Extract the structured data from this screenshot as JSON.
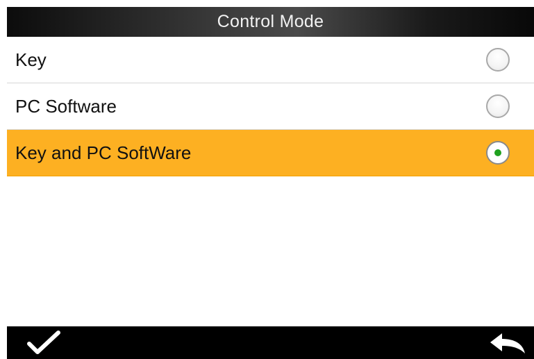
{
  "header": {
    "title": "Control Mode"
  },
  "options": [
    {
      "label": "Key",
      "selected": false
    },
    {
      "label": "PC Software",
      "selected": false
    },
    {
      "label": "Key and PC SoftWare",
      "selected": true
    }
  ],
  "toolbar": {
    "confirm_icon": "checkmark-icon",
    "back_icon": "back-arrow-icon"
  },
  "colors": {
    "selected_row": "#fdb022",
    "radio_dot": "#1fa11f",
    "bar_background": "#000000",
    "title_text": "#f2f2f2"
  }
}
